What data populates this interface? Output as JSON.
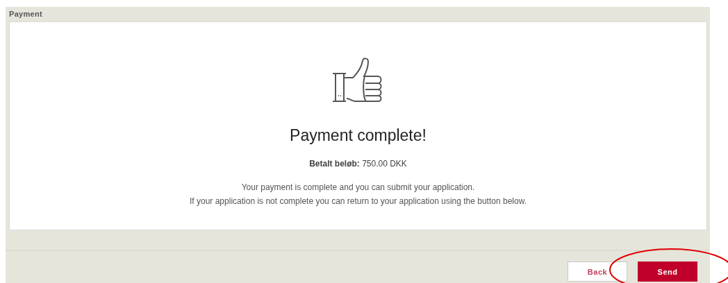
{
  "panel": {
    "title": "Payment"
  },
  "confirmation": {
    "heading": "Payment complete!",
    "amount_label": "Betalt beløb:",
    "amount": "750.00 DKK",
    "messages": [
      "Your payment is complete and you can submit your application.",
      "If your application is not complete you can return to your application using the button below."
    ]
  },
  "buttons": [
    {
      "kind": "secondary",
      "label": "Back"
    },
    {
      "kind": "primary",
      "label": "Send"
    }
  ]
}
